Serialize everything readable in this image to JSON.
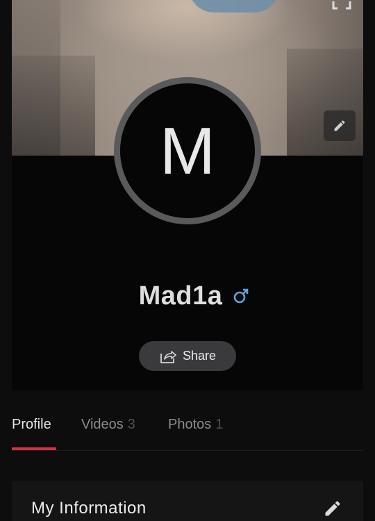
{
  "profile": {
    "avatar_letter": "M",
    "name": "Mad1a",
    "gender_icon": "male-symbol-icon",
    "gender_color": "#5aa6e0",
    "share_label": "Share"
  },
  "tabs": [
    {
      "label": "Profile",
      "count": ""
    },
    {
      "label": "Videos",
      "count": "3"
    },
    {
      "label": "Photos",
      "count": "1"
    }
  ],
  "accent_color": "#d0333d",
  "info_section": {
    "title": "My Information"
  }
}
